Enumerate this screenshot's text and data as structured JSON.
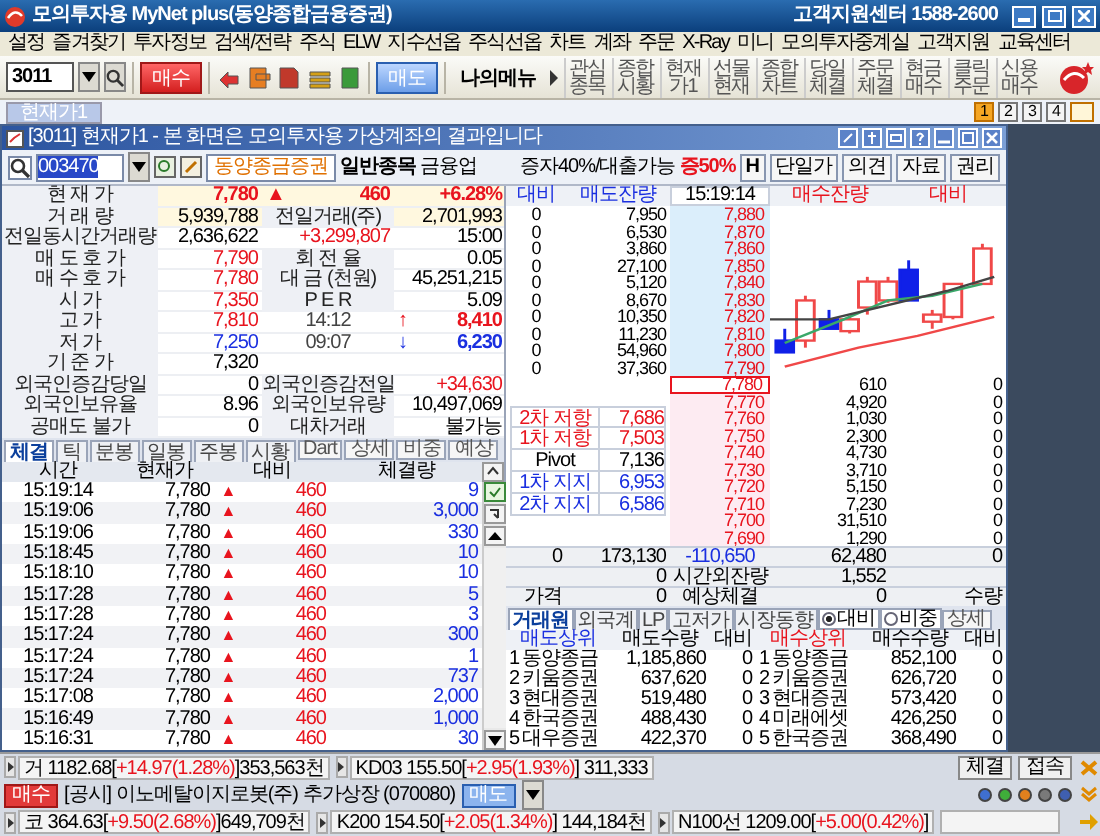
{
  "window": {
    "title": "모의투자용 MyNet plus(동양종합금융증권)",
    "support": "고객지원센터 1588-2600"
  },
  "menu": [
    "설정",
    "즐겨찾기",
    "투자정보",
    "검색/전략",
    "주식",
    "ELW",
    "지수선옵",
    "주식선옵",
    "차트",
    "계좌",
    "주문",
    "X-Ray",
    "미니",
    "모의투자중계실",
    "고객지원",
    "교육센터"
  ],
  "toolbar": {
    "code": "3011",
    "buy": "매수",
    "sell": "매도",
    "my_menu": "나의메뉴",
    "shortcuts": [
      "관심\n종목",
      "종합\n시황",
      "현재\n가1",
      "선물\n현재",
      "종합\n차트",
      "당일\n체결",
      "주문\n체결",
      "현금\n매수",
      "클릭\n주문",
      "신용\n매수"
    ]
  },
  "screen_tabs": [
    {
      "label": "현재가1",
      "selected": true
    }
  ],
  "pages": [
    {
      "label": "1",
      "selected": true
    },
    {
      "label": "2",
      "selected": false
    },
    {
      "label": "3",
      "selected": false
    },
    {
      "label": "4",
      "selected": false
    }
  ],
  "quote_window": {
    "title": "[3011] 현재가1 - 본 화면은 모의투자용 가상계좌의 결과입니다",
    "code": "003470",
    "name": "동양종금증권",
    "type": "일반종목",
    "sector": "금융업",
    "margin": "증자40%/대출가능",
    "margin_rate": "증50%",
    "buttons": [
      "H",
      "단일가",
      "의견",
      "자료",
      "권리"
    ],
    "info_rows": [
      {
        "shaded": true,
        "cells": [
          {
            "kind": "label",
            "text": "현 재 가"
          },
          {
            "kind": "value",
            "text": "7,780",
            "color": "#e8141e",
            "bold": true
          },
          {
            "kind": "value",
            "arrow": "▲",
            "text": "460",
            "color": "#e8141e",
            "bold": true
          },
          {
            "kind": "value",
            "text": "+6.28%",
            "color": "#e8141e",
            "bold": true
          }
        ]
      },
      {
        "shaded": true,
        "cells": [
          {
            "kind": "label",
            "text": "거 래 량"
          },
          {
            "kind": "value",
            "text": "5,939,788"
          },
          {
            "kind": "label",
            "text": "전일거래(주)"
          },
          {
            "kind": "value",
            "text": "2,701,993"
          }
        ]
      },
      {
        "shaded": false,
        "cells": [
          {
            "kind": "label",
            "text": "전일동시간거래량"
          },
          {
            "kind": "value",
            "text": "2,636,622"
          },
          {
            "kind": "value",
            "text": "+3,299,807",
            "color": "#e8141e"
          },
          {
            "kind": "value",
            "text": "15:00"
          }
        ]
      },
      {
        "shaded": false,
        "cells": [
          {
            "kind": "label",
            "text": "매 도 호 가"
          },
          {
            "kind": "value",
            "text": "7,790",
            "color": "#e8141e"
          },
          {
            "kind": "label",
            "text": "회 전 율"
          },
          {
            "kind": "value",
            "text": "0.05"
          }
        ]
      },
      {
        "shaded": false,
        "cells": [
          {
            "kind": "label",
            "text": "매 수 호 가"
          },
          {
            "kind": "value",
            "text": "7,780",
            "color": "#e8141e"
          },
          {
            "kind": "label",
            "text": "대 금 (천원)"
          },
          {
            "kind": "value",
            "text": "45,251,215"
          }
        ]
      },
      {
        "shaded": false,
        "cells": [
          {
            "kind": "label",
            "text": "시 가"
          },
          {
            "kind": "value",
            "text": "7,350",
            "color": "#e8141e"
          },
          {
            "kind": "label",
            "text": "P E R"
          },
          {
            "kind": "value",
            "text": "5.09"
          }
        ]
      },
      {
        "shaded": false,
        "cells": [
          {
            "kind": "label",
            "text": "고 가"
          },
          {
            "kind": "value",
            "text": "7,810",
            "color": "#e8141e"
          },
          {
            "kind": "time",
            "text": "14:12"
          },
          {
            "kind": "value",
            "arrow": "↑",
            "text": "8,410",
            "color": "#e8141e",
            "bold": true
          }
        ]
      },
      {
        "shaded": false,
        "cells": [
          {
            "kind": "label",
            "text": "저 가"
          },
          {
            "kind": "value",
            "text": "7,250",
            "color": "#1a2fe0"
          },
          {
            "kind": "time",
            "text": "09:07"
          },
          {
            "kind": "value",
            "arrow": "↓",
            "text": "6,230",
            "color": "#1a2fe0",
            "bold": true
          }
        ]
      },
      {
        "shaded": false,
        "cells": [
          {
            "kind": "label",
            "text": "기 준 가"
          },
          {
            "kind": "value",
            "text": "7,320"
          }
        ]
      },
      {
        "shaded": false,
        "cells": [
          {
            "kind": "label",
            "text": "외국인증감당일"
          },
          {
            "kind": "value",
            "text": "0"
          },
          {
            "kind": "label",
            "text": "외국인증감전일"
          },
          {
            "kind": "value",
            "text": "+34,630",
            "color": "#e8141e"
          }
        ]
      },
      {
        "shaded": false,
        "cells": [
          {
            "kind": "label",
            "text": "외국인보유율"
          },
          {
            "kind": "value",
            "text": "8.96"
          },
          {
            "kind": "label",
            "text": "외국인보유량"
          },
          {
            "kind": "value",
            "text": "10,497,069"
          }
        ]
      },
      {
        "shaded": false,
        "cells": [
          {
            "kind": "label",
            "text": "공매도 불가"
          },
          {
            "kind": "value",
            "text": "0"
          },
          {
            "kind": "label",
            "text": "대차거래"
          },
          {
            "kind": "value",
            "text": "불가능"
          }
        ]
      }
    ],
    "tabs": [
      {
        "kind": "tab",
        "label": "체결",
        "selected": true
      },
      {
        "kind": "tab",
        "label": "틱",
        "selected": false
      },
      {
        "kind": "tab",
        "label": "분봉",
        "selected": false
      },
      {
        "kind": "tab",
        "label": "일봉",
        "selected": false
      },
      {
        "kind": "tab",
        "label": "주봉",
        "selected": false
      },
      {
        "kind": "tab",
        "label": "시황",
        "selected": false
      },
      {
        "kind": "button",
        "label": "Dart"
      },
      {
        "kind": "button",
        "label": "상세"
      },
      {
        "kind": "button",
        "label": "비중"
      },
      {
        "kind": "button",
        "label": "예상"
      }
    ],
    "trades": {
      "columns": [
        "시간",
        "현재가",
        "대비",
        "체결량"
      ],
      "rows": [
        {
          "time": "15:19:14",
          "price": "7,780",
          "arrow": "▲",
          "diff": "460",
          "volume": "9"
        },
        {
          "time": "15:19:06",
          "price": "7,780",
          "arrow": "▲",
          "diff": "460",
          "volume": "3,000"
        },
        {
          "time": "15:19:06",
          "price": "7,780",
          "arrow": "▲",
          "diff": "460",
          "volume": "330"
        },
        {
          "time": "15:18:45",
          "price": "7,780",
          "arrow": "▲",
          "diff": "460",
          "volume": "10"
        },
        {
          "time": "15:18:10",
          "price": "7,780",
          "arrow": "▲",
          "diff": "460",
          "volume": "10"
        },
        {
          "time": "15:17:28",
          "price": "7,780",
          "arrow": "▲",
          "diff": "460",
          "volume": "5"
        },
        {
          "time": "15:17:28",
          "price": "7,780",
          "arrow": "▲",
          "diff": "460",
          "volume": "3"
        },
        {
          "time": "15:17:24",
          "price": "7,780",
          "arrow": "▲",
          "diff": "460",
          "volume": "300"
        },
        {
          "time": "15:17:24",
          "price": "7,780",
          "arrow": "▲",
          "diff": "460",
          "volume": "1"
        },
        {
          "time": "15:17:24",
          "price": "7,780",
          "arrow": "▲",
          "diff": "460",
          "volume": "737"
        },
        {
          "time": "15:17:08",
          "price": "7,780",
          "arrow": "▲",
          "diff": "460",
          "volume": "2,000"
        },
        {
          "time": "15:16:49",
          "price": "7,780",
          "arrow": "▲",
          "diff": "460",
          "volume": "1,000"
        },
        {
          "time": "15:16:31",
          "price": "7,780",
          "arrow": "▲",
          "diff": "460",
          "volume": "30"
        }
      ]
    },
    "orderbook": {
      "columns": [
        "대비",
        "매도잔량",
        "15:19:14",
        "매수잔량",
        "대비"
      ],
      "asks": [
        {
          "diff": "0",
          "volume": "7,950",
          "price": "7,880"
        },
        {
          "diff": "0",
          "volume": "6,530",
          "price": "7,870"
        },
        {
          "diff": "0",
          "volume": "3,860",
          "price": "7,860"
        },
        {
          "diff": "0",
          "volume": "27,100",
          "price": "7,850"
        },
        {
          "diff": "0",
          "volume": "5,120",
          "price": "7,840"
        },
        {
          "diff": "0",
          "volume": "8,670",
          "price": "7,830"
        },
        {
          "diff": "0",
          "volume": "10,350",
          "price": "7,820"
        },
        {
          "diff": "0",
          "volume": "11,230",
          "price": "7,810"
        },
        {
          "diff": "0",
          "volume": "54,960",
          "price": "7,800"
        },
        {
          "diff": "0",
          "volume": "37,360",
          "price": "7,790"
        }
      ],
      "bids": [
        {
          "price": "7,780",
          "volume": "610",
          "diff": "0",
          "current": true
        },
        {
          "price": "7,770",
          "volume": "4,920",
          "diff": "0",
          "current": false
        },
        {
          "price": "7,760",
          "volume": "1,030",
          "diff": "0",
          "current": false
        },
        {
          "price": "7,750",
          "volume": "2,300",
          "diff": "0",
          "current": false
        },
        {
          "price": "7,740",
          "volume": "4,730",
          "diff": "0",
          "current": false
        },
        {
          "price": "7,730",
          "volume": "3,710",
          "diff": "0",
          "current": false
        },
        {
          "price": "7,720",
          "volume": "5,150",
          "diff": "0",
          "current": false
        },
        {
          "price": "7,710",
          "volume": "7,230",
          "diff": "0",
          "current": false
        },
        {
          "price": "7,700",
          "volume": "31,510",
          "diff": "0",
          "current": false
        },
        {
          "price": "7,690",
          "volume": "1,290",
          "diff": "0",
          "current": false
        }
      ],
      "pivots": [
        {
          "label": "2차 저항",
          "value": "7,686",
          "color": "#e8141e"
        },
        {
          "label": "1차 저항",
          "value": "7,503",
          "color": "#e8141e"
        },
        {
          "label": "Pivot",
          "value": "7,136"
        },
        {
          "label": "1차 지지",
          "value": "6,953",
          "color": "#1a2fe0"
        },
        {
          "label": "2차 지지",
          "value": "6,586",
          "color": "#1a2fe0"
        }
      ],
      "totals": [
        {
          "col_1": "0",
          "col_2": "173,130",
          "col_3": "-110,650",
          "col_4": "62,480",
          "col_5": "0"
        },
        {
          "col_2": "0",
          "col_3": "시간외잔량",
          "col_4": "1,552"
        },
        {
          "col_1": "가격",
          "col_2": "0",
          "col_3": "예상체결",
          "col_4": "0",
          "col_5": "수량"
        }
      ]
    },
    "broker_tabs": [
      {
        "kind": "tab",
        "label": "거래원",
        "selected": true
      },
      {
        "kind": "tab",
        "label": "외국계",
        "selected": false
      },
      {
        "kind": "tab",
        "label": "LP",
        "selected": false
      },
      {
        "kind": "tab",
        "label": "고저가",
        "selected": false
      },
      {
        "kind": "tab",
        "label": "시장동향",
        "selected": false
      },
      {
        "kind": "radio",
        "label": "대비",
        "selected": true
      },
      {
        "kind": "radio",
        "label": "비중",
        "selected": false
      },
      {
        "kind": "button",
        "label": "상세"
      }
    ],
    "brokers": {
      "columns": [
        "매도상위",
        "매도수량",
        "대비",
        "매수상위",
        "매수수량",
        "대비"
      ],
      "rows": [
        {
          "sell_rank": "1",
          "sell_name": "동양종금",
          "sell_qty": "1,185,860",
          "sell_diff": "0",
          "buy_rank": "1",
          "buy_name": "동양종금",
          "buy_qty": "852,100",
          "buy_diff": "0"
        },
        {
          "sell_rank": "2",
          "sell_name": "키움증권",
          "sell_qty": "637,620",
          "sell_diff": "0",
          "buy_rank": "2",
          "buy_name": "키움증권",
          "buy_qty": "626,720",
          "buy_diff": "0"
        },
        {
          "sell_rank": "3",
          "sell_name": "현대증권",
          "sell_qty": "519,480",
          "sell_diff": "0",
          "buy_rank": "3",
          "buy_name": "현대증권",
          "buy_qty": "573,420",
          "buy_diff": "0"
        },
        {
          "sell_rank": "4",
          "sell_name": "한국증권",
          "sell_qty": "488,430",
          "sell_diff": "0",
          "buy_rank": "4",
          "buy_name": "미래에셋",
          "buy_qty": "426,250",
          "buy_diff": "0"
        },
        {
          "sell_rank": "5",
          "sell_name": "대우증권",
          "sell_qty": "422,370",
          "sell_diff": "0",
          "buy_rank": "5",
          "buy_name": "한국증권",
          "buy_qty": "368,490",
          "buy_diff": "0"
        }
      ]
    }
  },
  "status_bar": {
    "tickers": [
      {
        "prefix": "거 1182.68[",
        "change": "+14.97(1.28%)",
        "suffix": "]353,563천"
      },
      {
        "prefix": "KD03 155.50[",
        "change": "+2.95(1.93%)",
        "suffix": "] 311,333"
      },
      {
        "prefix": "코 364.63[",
        "change": "+9.50(2.68%)",
        "suffix": "]649,709천"
      },
      {
        "prefix": "K200 154.50[",
        "change": "+2.05(1.34%)",
        "suffix": "] 144,184천"
      },
      {
        "prefix": "N100선 1209.00[",
        "change": "+5.00(0.42%)",
        "suffix": "]"
      }
    ],
    "buy": "매수",
    "notice": "[공시] 이노메탈이지로봇(주) 추가상장 (070080)",
    "sell": "매도",
    "buttons": [
      "체결",
      "접속"
    ],
    "indicators": [
      {
        "color": "#3f6fd0"
      },
      {
        "color": "#3fae3a"
      },
      {
        "color": "#e0801e"
      },
      {
        "color": "#7a7a7a"
      },
      {
        "color": "#3f5fb0"
      }
    ]
  }
}
